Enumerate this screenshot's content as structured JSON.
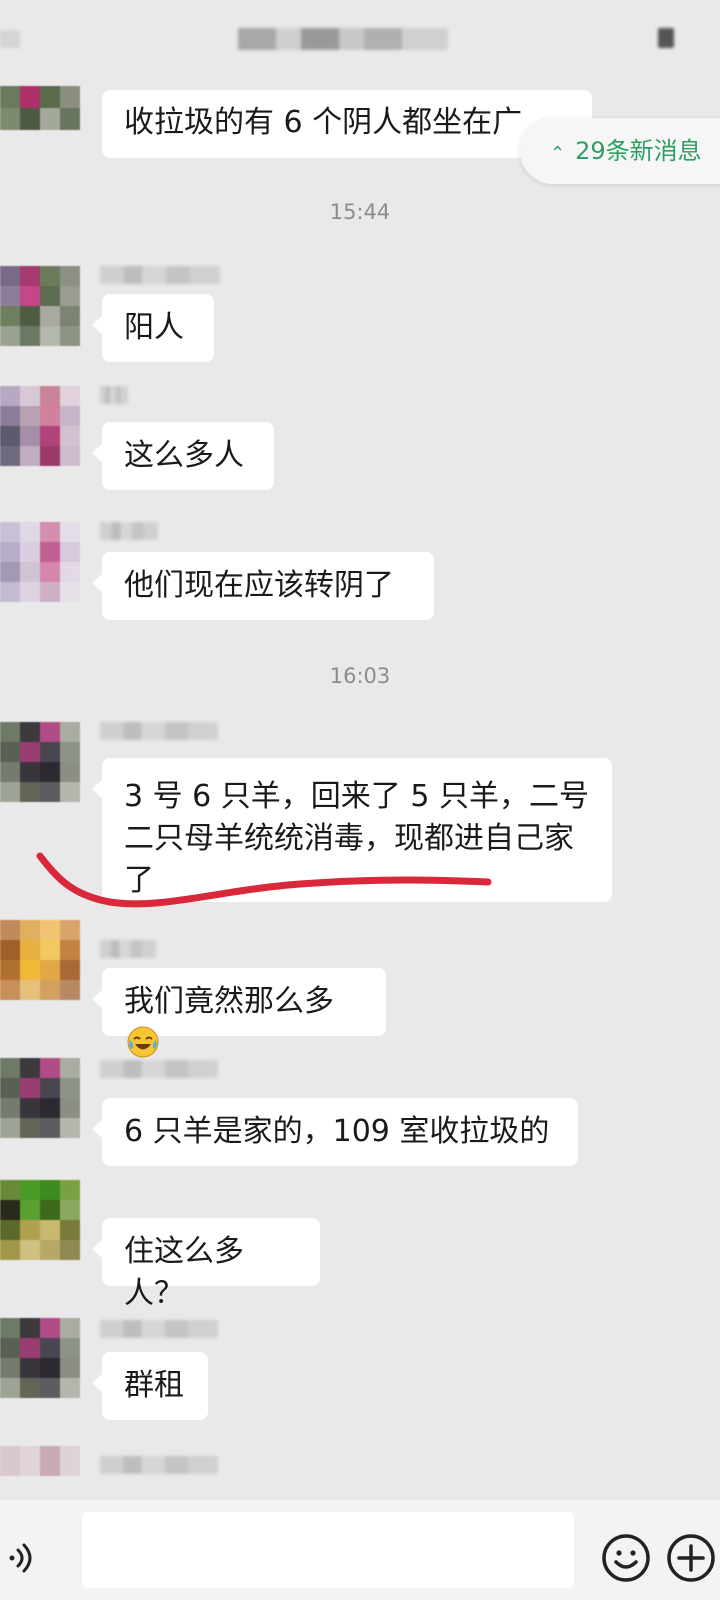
{
  "new_messages_label": "29条新消息",
  "messages": [
    {
      "text": "收拉圾的有 6 个阴人都坐在广"
    },
    {
      "text": "阳人"
    },
    {
      "text": "这么多人"
    },
    {
      "text": "他们现在应该转阴了"
    },
    {
      "text": "3 号 6 只羊，回来了 5 只羊，二号二只母羊统统消毒，现都进自己家了"
    },
    {
      "text": "我们竟然那么多",
      "emoji": "tears-of-joy"
    },
    {
      "text": "6 只羊是家的，109 室收拉圾的"
    },
    {
      "text": "住这么多人？"
    },
    {
      "text": "群租"
    }
  ],
  "timestamps": [
    "15:44",
    "16:03"
  ],
  "colors": {
    "accent_green": "#2e9e64",
    "annotation_red": "#d8283a",
    "bubble": "#ffffff",
    "background": "#e9e9e9"
  },
  "icons": [
    "voice-icon",
    "emoji-icon",
    "plus-icon",
    "chevron-up-double-icon"
  ]
}
